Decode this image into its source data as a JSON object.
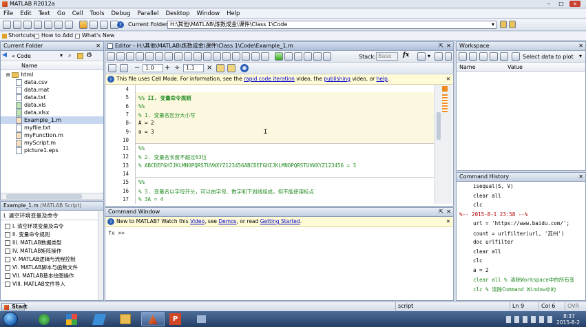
{
  "window": {
    "title": "MATLAB  R2012a"
  },
  "menu": [
    "File",
    "Edit",
    "Text",
    "Go",
    "Cell",
    "Tools",
    "Debug",
    "Parallel",
    "Desktop",
    "Window",
    "Help"
  ],
  "toolbar": {
    "current_folder_label": "Current Folder:",
    "current_folder_path": "H:\\其他\\MATLAB\\炼数成金\\课件\\Class 1\\Code"
  },
  "shortcuts": {
    "shortcuts": "Shortcuts",
    "how_to_add": "How to Add",
    "whats_new": "What's New"
  },
  "current_folder": {
    "title": "Current Folder",
    "path": "« Code",
    "column_name": "Name",
    "files": [
      "html",
      "data.csv",
      "data.mat",
      "data.txt",
      "data.xls",
      "data.xlsx",
      "Example_1.m",
      "myfile.txt",
      "myFunction.m",
      "myScript.m",
      "picture1.eps"
    ],
    "selected": "Example_1.m"
  },
  "details": {
    "file": "Example_1.m",
    "type": "(MATLAB Script)",
    "root": "I. 清空环境变量及命令",
    "items": [
      "I. 清空环境变量及命令",
      "II. 变量命令规则",
      "III. MATLAB数据类型",
      "IV. MATLAB矩阵操作",
      "V. MATLAB逻辑与流程控制",
      "VI. MATLAB脚本与函数文件",
      "VII. MATLAB基本绘图操作",
      "VIII. MATLAB文件导入"
    ]
  },
  "editor": {
    "title": "Editor - H:\\其他\\MATLAB\\炼数成金\\课件\\Class 1\\Code\\Example_1.m",
    "stack_label": "Stack:",
    "stack_value": "Base",
    "cell_minus": "1.0",
    "cell_div": "1.1",
    "info": {
      "prefix": "This file uses Cell Mode. For information, see the ",
      "link1": "rapid code iteration",
      "mid1": " video, the ",
      "link2": "publishing",
      "mid2": " video, or ",
      "link3": "help",
      "suffix": "."
    },
    "lines": [
      {
        "n": "4",
        "dash": "",
        "text": "",
        "cls": ""
      },
      {
        "n": "5",
        "dash": "",
        "text": "%% II. 变量命令规则",
        "cls": "cm"
      },
      {
        "n": "6",
        "dash": "",
        "text": "%%",
        "cls": "cm"
      },
      {
        "n": "7",
        "dash": "",
        "text": "% 1. 变量名区分大小写",
        "cls": "cm"
      },
      {
        "n": "8",
        "dash": "-",
        "text": "A = 2",
        "cls": ""
      },
      {
        "n": "9",
        "dash": "-",
        "text": "a = 3",
        "cls": ""
      },
      {
        "n": "10",
        "dash": "",
        "text": "",
        "cls": ""
      },
      {
        "n": "11",
        "dash": "",
        "text": "%%",
        "cls": "cm"
      },
      {
        "n": "12",
        "dash": "",
        "text": "% 2. 变量名长度不超过63位",
        "cls": "cm"
      },
      {
        "n": "13",
        "dash": "",
        "text": "% ABCDEFGHIJKLMNOPQRSTUVWXYZ123456ABCDEFGHIJKLMNOPQRSTUVWXYZ123456 = 3",
        "cls": "cm"
      },
      {
        "n": "14",
        "dash": "",
        "text": "",
        "cls": ""
      },
      {
        "n": "15",
        "dash": "",
        "text": "%%",
        "cls": "cm"
      },
      {
        "n": "16",
        "dash": "",
        "text": "% 3. 变量名以字母开头，可以由字母、数字和下划线组成，但不能使用标点",
        "cls": "cm"
      },
      {
        "n": "17",
        "dash": "",
        "text": "% 3A = 4",
        "cls": "cm"
      }
    ]
  },
  "command_window": {
    "title": "Command Window",
    "info_prefix": "New to MATLAB? Watch this ",
    "link_video": "Video",
    "info_mid1": ", see ",
    "link_demos": "Demos",
    "info_mid2": ", or read ",
    "link_started": "Getting Started",
    "info_suffix": ".",
    "prompt": "fx >>"
  },
  "workspace": {
    "title": "Workspace",
    "select_label": "Select data to plot",
    "col_name": "Name",
    "col_value": "Value"
  },
  "history": {
    "title": "Command History",
    "lines": [
      {
        "t": "isequal(S, V)",
        "kind": "plain"
      },
      {
        "t": "clear all",
        "kind": "kwarg"
      },
      {
        "t": "clc",
        "kind": "plain"
      },
      {
        "t": "%-- 2015-8-1 23:58 --%",
        "kind": "session"
      },
      {
        "t": "url = 'https://www.baidu.com/';",
        "kind": "str"
      },
      {
        "t": "count = urlfilter(url, '苏州')",
        "kind": "str"
      },
      {
        "t": "doc urlfilter",
        "kind": "kwarg"
      },
      {
        "t": "clear all",
        "kind": "kwarg"
      },
      {
        "t": "clc",
        "kind": "plain"
      },
      {
        "t": "a = 2",
        "kind": "plain"
      },
      {
        "t": "clear all    % 清除Workspace中的所有变",
        "kind": "mixed"
      },
      {
        "t": "clc    % 清除Command Window中的",
        "kind": "mixed"
      }
    ]
  },
  "status": {
    "start": "Start",
    "mode": "script",
    "ln": "Ln  9",
    "col": "Col  6",
    "ovr": "OVR"
  },
  "taskbar": {
    "time": "8:37",
    "date": "2015-8-2"
  }
}
